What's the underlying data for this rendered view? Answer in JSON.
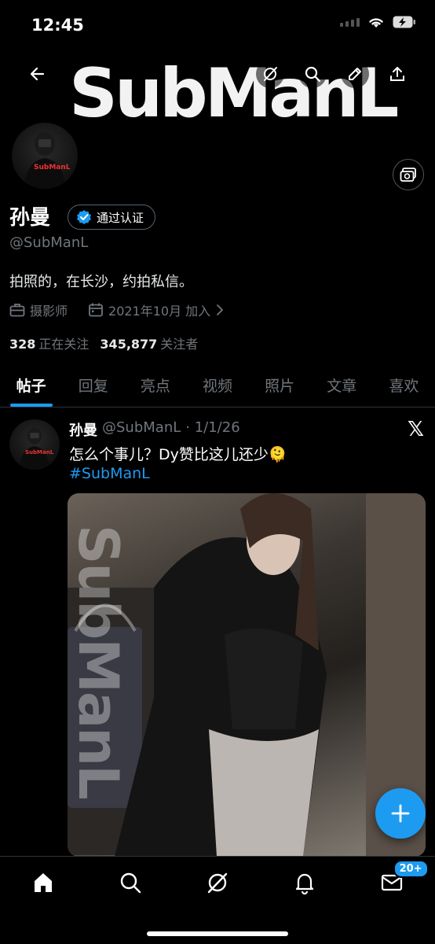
{
  "status_bar": {
    "time": "12:45"
  },
  "banner": {
    "logo_text": "SubManL"
  },
  "profile": {
    "display_name": "孙曼",
    "verified_label": "通过认证",
    "handle": "@SubManL",
    "bio": "拍照的，在长沙，约拍私信。",
    "profession": "摄影师",
    "joined": "2021年10月 加入",
    "following_count": "328",
    "following_label": "正在关注",
    "followers_count": "345,877",
    "followers_label": "关注者",
    "avatar_shirt_text": "SubManL"
  },
  "tabs": [
    {
      "label": "帖子",
      "active": true
    },
    {
      "label": "回复"
    },
    {
      "label": "亮点"
    },
    {
      "label": "视频"
    },
    {
      "label": "照片"
    },
    {
      "label": "文章"
    },
    {
      "label": "喜欢"
    }
  ],
  "post": {
    "author_name": "孙曼",
    "author_handle": "@SubManL",
    "date": "· 1/1/26",
    "text": "怎么个事儿？Dy赞比这儿还少🫠",
    "hashtag": "#SubManL",
    "image_watermark": "SubManL"
  },
  "bottom_nav": {
    "messages_badge": "20+"
  },
  "colors": {
    "accent": "#1d9bf0",
    "background": "#000000",
    "muted": "#71767b"
  }
}
